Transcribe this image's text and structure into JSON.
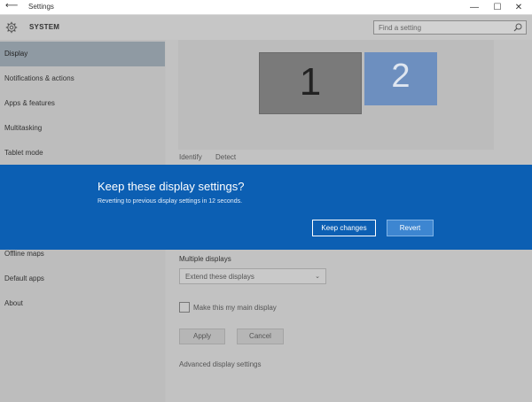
{
  "window": {
    "title": "Settings",
    "back_glyph": "⟵",
    "min_glyph": "—",
    "max_glyph": "☐",
    "close_glyph": "✕"
  },
  "header": {
    "title": "SYSTEM",
    "search_placeholder": "Find a setting"
  },
  "sidebar": {
    "items": [
      {
        "label": "Display"
      },
      {
        "label": "Notifications & actions"
      },
      {
        "label": "Apps & features"
      },
      {
        "label": "Multitasking"
      },
      {
        "label": "Tablet mode"
      },
      {
        "label": "Offline maps"
      },
      {
        "label": "Default apps"
      },
      {
        "label": "About"
      }
    ]
  },
  "display": {
    "monitor1": "1",
    "monitor2": "2",
    "identify": "Identify",
    "detect": "Detect",
    "multiple_displays_label": "Multiple displays",
    "multiple_displays_value": "Extend these displays",
    "main_display_checkbox": "Make this my main display",
    "apply": "Apply",
    "cancel": "Cancel",
    "advanced": "Advanced display settings"
  },
  "dialog": {
    "title": "Keep these display settings?",
    "message": "Reverting to previous display settings in 12 seconds.",
    "keep": "Keep changes",
    "revert": "Revert"
  },
  "colors": {
    "dialog_bg": "#0c5fb3",
    "accent": "#3d86d1"
  }
}
